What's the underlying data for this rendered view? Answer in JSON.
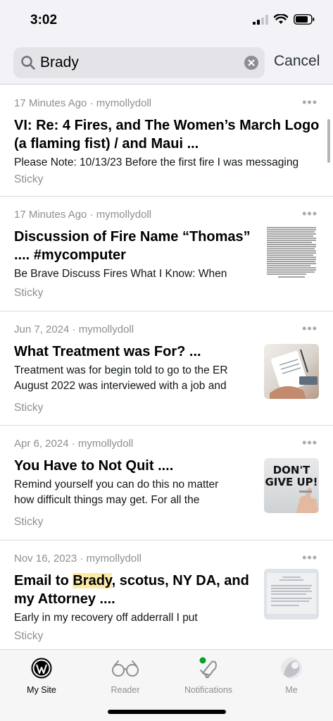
{
  "status_bar": {
    "time": "3:02"
  },
  "search": {
    "query": "Brady",
    "cancel_label": "Cancel"
  },
  "posts": [
    {
      "meta": "17 Minutes Ago · mymollydoll",
      "title_line1": "VI: Re: 4 Fires, and The Women’s March Logo",
      "title_line2": "(a flaming fist) / and Maui ...",
      "excerpt_line1": "Please Note: 10/13/23 Before the first fire I was messaging",
      "excerpt_line2": "",
      "tag": "Sticky",
      "more": "•••"
    },
    {
      "meta": "17 Minutes Ago · mymollydoll",
      "title_line1": "Discussion of Fire Name “Thomas”",
      "title_line2": ".... #mycomputer",
      "excerpt_line1": "Be Brave Discuss Fires What I Know: When",
      "excerpt_line2": "",
      "tag": "Sticky",
      "more": "•••"
    },
    {
      "meta": "Jun 7, 2024 · mymollydoll",
      "title_line1": "What Treatment was For? ...",
      "title_line2": "",
      "excerpt_line1": "Treatment was for begin told to go to the ER",
      "excerpt_line2": "August 2022 was interviewed with a job and",
      "tag": "Sticky",
      "more": "•••"
    },
    {
      "meta": "Apr 6, 2024 · mymollydoll",
      "title_line1": "You Have to Not Quit ....",
      "title_line2": "",
      "excerpt_line1": "Remind yourself you can do this no matter",
      "excerpt_line2": "how difficult things may get. For all the",
      "tag": "Sticky",
      "more": "•••",
      "thumb_text_1": "DON'T",
      "thumb_text_2": "GIVE UP!"
    },
    {
      "meta": "Nov 16, 2023 · mymollydoll",
      "title_pre": "Email to ",
      "title_highlight": "Brady",
      "title_post": ", scotus, NY DA, and",
      "title_line2": "my Attorney ....",
      "excerpt_line1": "Early in my recovery off adderrall I put",
      "excerpt_line2": "",
      "tag": "Sticky",
      "more": "•••"
    }
  ],
  "tabs": [
    {
      "label": "My Site",
      "active": true
    },
    {
      "label": "Reader",
      "active": false
    },
    {
      "label": "Notifications",
      "active": false
    },
    {
      "label": "Me",
      "active": false
    }
  ],
  "colors": {
    "notification_dot": "#00a32a",
    "highlight": "#fbeaa8"
  }
}
